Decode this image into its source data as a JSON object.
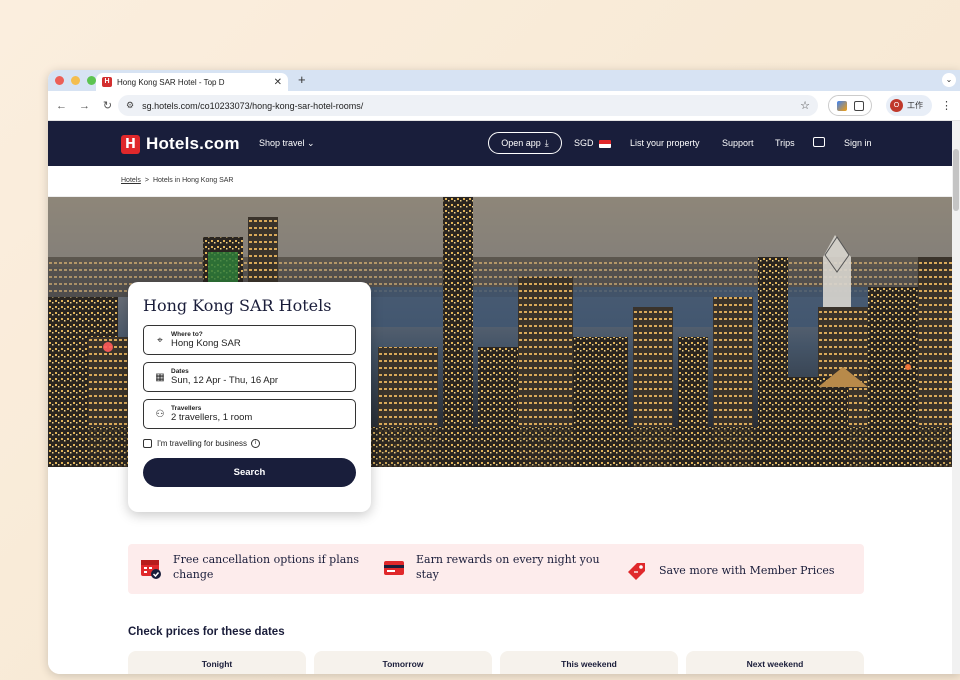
{
  "browser": {
    "tab_title": "Hong Kong SAR Hotel - Top D",
    "tab_favicon": "H",
    "new_tab_symbol": "+",
    "url": "sg.hotels.com/co10233073/hong-kong-sar-hotel-rooms/",
    "profile_initial": "O",
    "profile_label": "工作"
  },
  "header": {
    "brand": "Hotels.com",
    "brand_mark": "H",
    "shop_travel": "Shop travel",
    "open_app": "Open app",
    "currency": "SGD",
    "list_property": "List your property",
    "support": "Support",
    "trips": "Trips",
    "sign_in": "Sign in"
  },
  "breadcrumb": {
    "root": "Hotels",
    "separator": ">",
    "current": "Hotels in Hong Kong SAR"
  },
  "search": {
    "title": "Hong Kong SAR Hotels",
    "where_label": "Where to?",
    "where_value": "Hong Kong SAR",
    "dates_label": "Dates",
    "dates_value": "Sun, 12 Apr - Thu, 16 Apr",
    "travellers_label": "Travellers",
    "travellers_value": "2 travellers, 1 room",
    "business_label": "I'm travelling for business",
    "button": "Search"
  },
  "benefits": [
    {
      "text": "Free cancellation options if plans change",
      "icon": "calendar-check-icon"
    },
    {
      "text": "Earn rewards on every night you stay",
      "icon": "rewards-card-icon"
    },
    {
      "text": "Save more with Member Prices",
      "icon": "price-tag-icon"
    }
  ],
  "dates_section": {
    "title": "Check prices for these dates",
    "cards": [
      "Tonight",
      "Tomorrow",
      "This weekend",
      "Next weekend"
    ]
  },
  "colors": {
    "brand_navy": "#191e3b",
    "brand_red": "#e0282b",
    "benefits_bg": "#fdecec"
  }
}
